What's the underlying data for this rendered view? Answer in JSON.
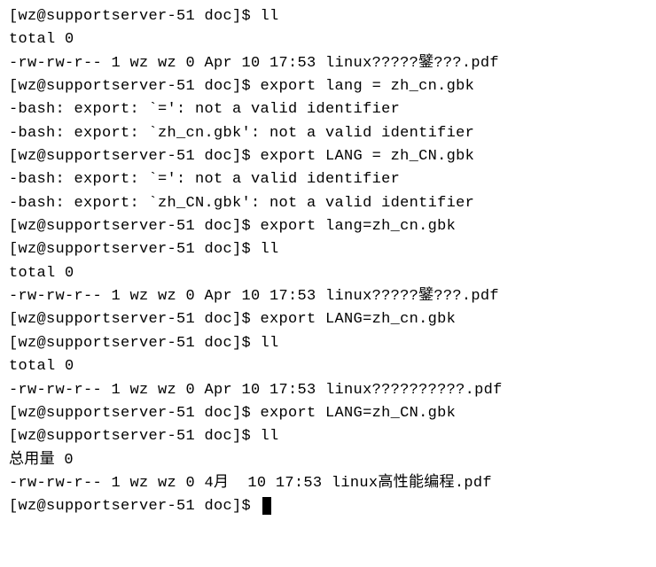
{
  "terminal": {
    "lines": [
      "[wz@supportserver-51 doc]$ ll",
      "total 0",
      "-rw-rw-r-- 1 wz wz 0 Apr 10 17:53 linux?????鐾???.pdf",
      "[wz@supportserver-51 doc]$ export lang = zh_cn.gbk",
      "-bash: export: `=': not a valid identifier",
      "-bash: export: `zh_cn.gbk': not a valid identifier",
      "[wz@supportserver-51 doc]$ export LANG = zh_CN.gbk",
      "-bash: export: `=': not a valid identifier",
      "-bash: export: `zh_CN.gbk': not a valid identifier",
      "[wz@supportserver-51 doc]$ export lang=zh_cn.gbk",
      "[wz@supportserver-51 doc]$ ll",
      "total 0",
      "-rw-rw-r-- 1 wz wz 0 Apr 10 17:53 linux?????鐾???.pdf",
      "[wz@supportserver-51 doc]$ export LANG=zh_cn.gbk",
      "[wz@supportserver-51 doc]$ ll",
      "total 0",
      "-rw-rw-r-- 1 wz wz 0 Apr 10 17:53 linux??????????.pdf",
      "[wz@supportserver-51 doc]$ export LANG=zh_CN.gbk",
      "[wz@supportserver-51 doc]$ ll",
      "总用量 0",
      "-rw-rw-r-- 1 wz wz 0 4月  10 17:53 linux高性能编程.pdf",
      "[wz@supportserver-51 doc]$ "
    ]
  }
}
